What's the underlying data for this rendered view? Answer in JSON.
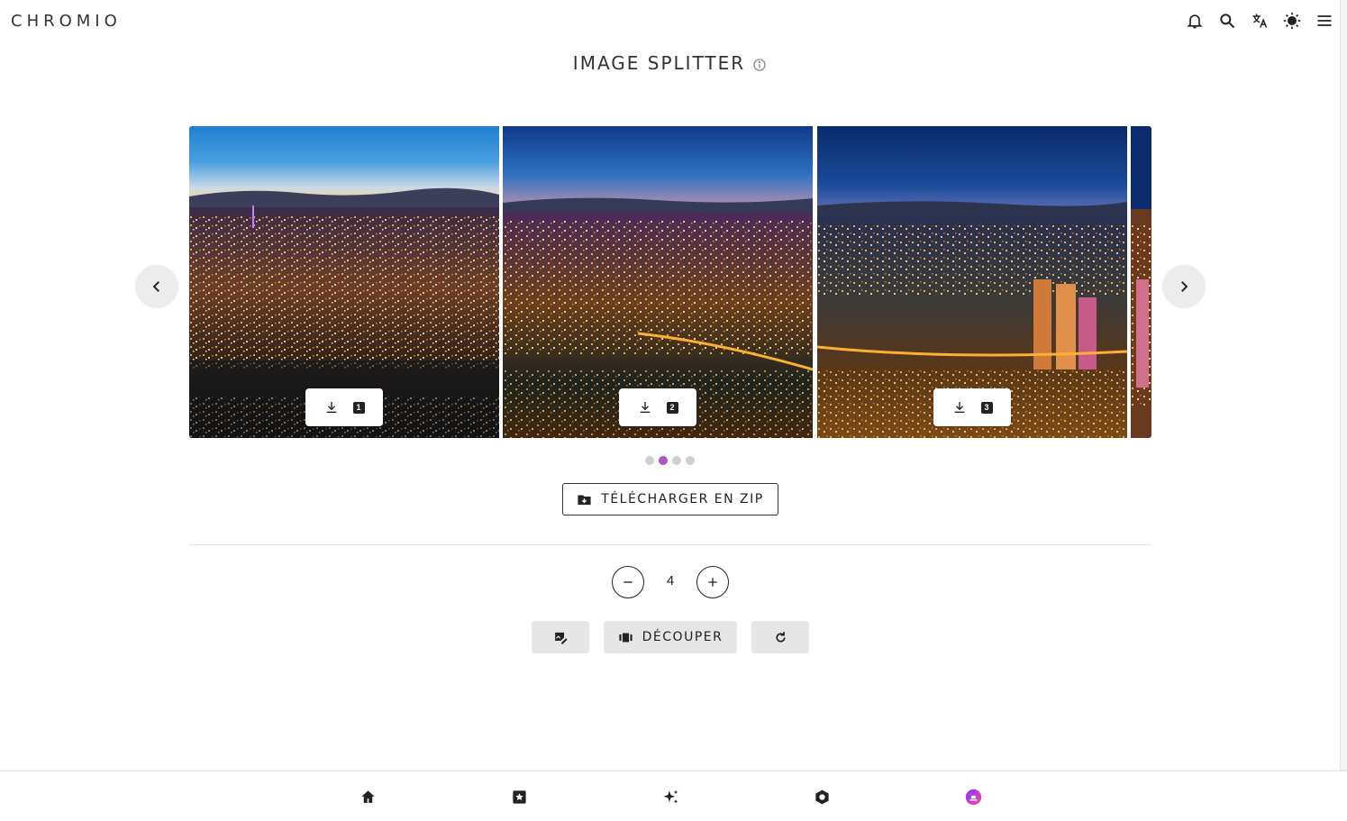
{
  "app": {
    "logo": "CHROMIO"
  },
  "topbar": {
    "icons": [
      "bell-icon",
      "search-icon",
      "translate-icon",
      "brightness-icon",
      "menu-icon"
    ]
  },
  "page": {
    "title": "IMAGE SPLITTER"
  },
  "carousel": {
    "tiles": [
      {
        "number": "1"
      },
      {
        "number": "2"
      },
      {
        "number": "3"
      }
    ],
    "active_dot": 2,
    "dot_count": 4
  },
  "actions": {
    "zip_label": "TÉLÉCHARGER EN ZIP",
    "split_count": "4",
    "cut_label": "DÉCOUPER"
  },
  "colors": {
    "accent": "#a855c8",
    "button_bg": "#e6e6e6",
    "text": "#222222"
  },
  "bottom_nav": {
    "items": [
      "home-icon",
      "star-box-icon",
      "sparkles-icon",
      "hexagon-icon",
      "app-avatar-icon"
    ]
  }
}
